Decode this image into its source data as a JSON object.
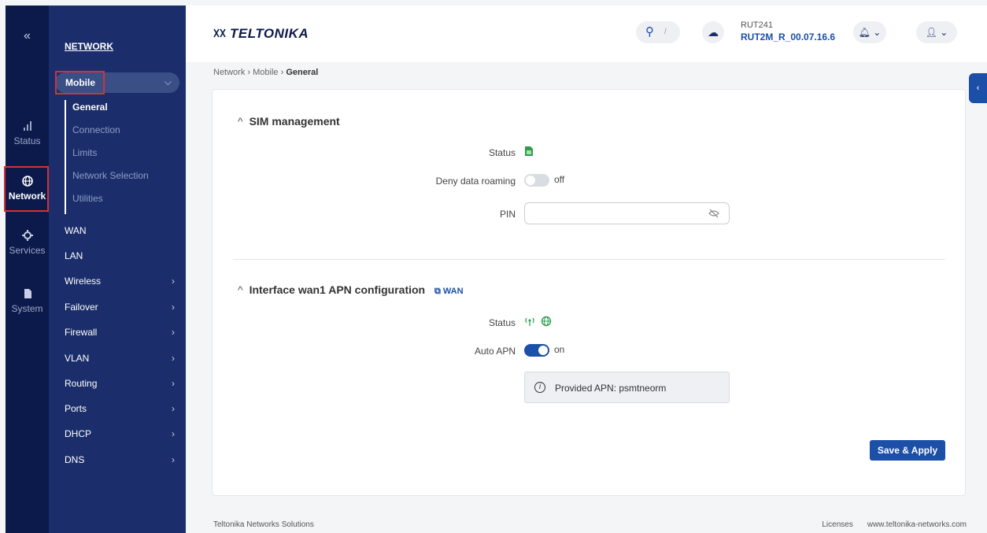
{
  "rail": {
    "collapse": "«",
    "items": [
      {
        "label": "Status",
        "icon": "signal-icon"
      },
      {
        "label": "Network",
        "icon": "globe-icon"
      },
      {
        "label": "Services",
        "icon": "gear-icon"
      },
      {
        "label": "System",
        "icon": "document-icon"
      }
    ]
  },
  "subnav": {
    "section": "NETWORK",
    "mobile": "Mobile",
    "mobile_sub": [
      "General",
      "Connection",
      "Limits",
      "Network Selection",
      "Utilities"
    ],
    "items": [
      "WAN",
      "LAN",
      "Wireless",
      "Failover",
      "Firewall",
      "VLAN",
      "Routing",
      "Ports",
      "DHCP",
      "DNS"
    ]
  },
  "header": {
    "logo": "TELTONIKA",
    "search_key": "/",
    "device_name": "RUT241",
    "firmware": "RUT2M_R_00.07.16.6"
  },
  "breadcrumb": {
    "a": "Network",
    "b": "Mobile",
    "c": "General"
  },
  "sim": {
    "title": "SIM management",
    "status_label": "Status",
    "deny_label": "Deny data roaming",
    "deny_value": "off",
    "pin_label": "PIN",
    "pin_value": ""
  },
  "apn": {
    "title": "Interface wan1 APN configuration",
    "link": "WAN",
    "status_label": "Status",
    "auto_label": "Auto APN",
    "auto_value": "on",
    "info": "Provided APN: psmtneorm"
  },
  "save_label": "Save & Apply",
  "footer": {
    "left": "Teltonika Networks Solutions",
    "licenses": "Licenses",
    "site": "www.teltonika-networks.com"
  },
  "colors": {
    "primary": "#1b4fa8",
    "navy": "#0c1a4b",
    "highlight": "#d0323a"
  }
}
